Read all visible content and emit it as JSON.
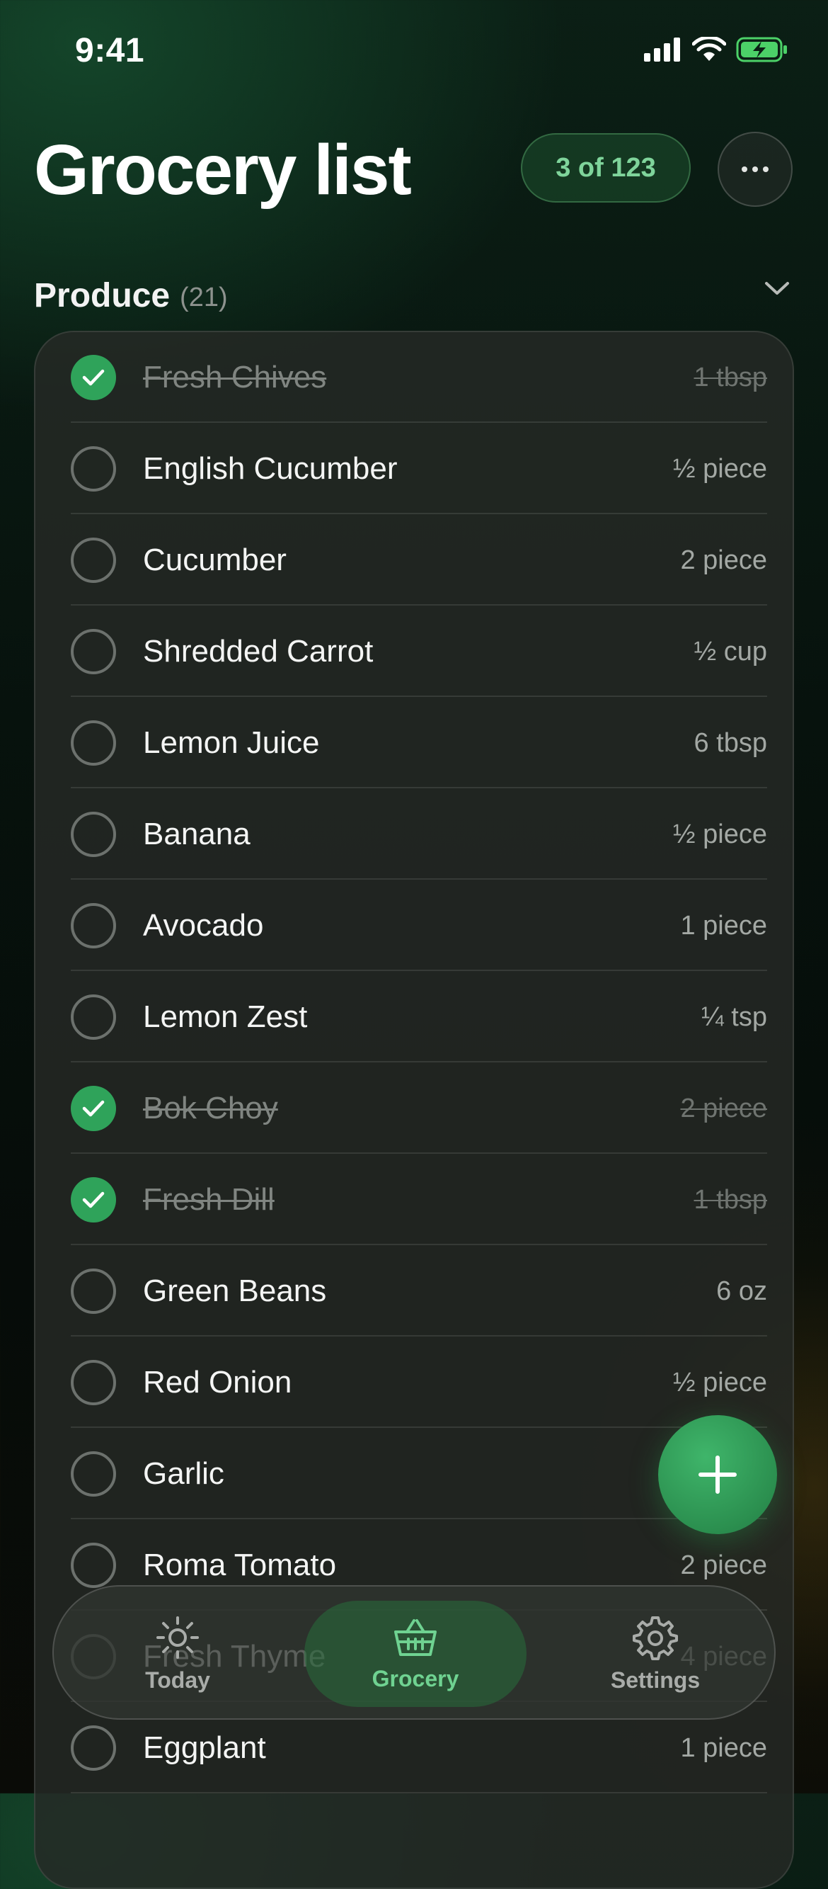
{
  "status_bar": {
    "time": "9:41"
  },
  "header": {
    "title": "Grocery list",
    "count_label": "3 of 123"
  },
  "section": {
    "title": "Produce",
    "count": "(21)",
    "items": [
      {
        "name": "Fresh Chives",
        "qty": "1 tbsp",
        "checked": true
      },
      {
        "name": "English Cucumber",
        "qty": "½ piece",
        "checked": false
      },
      {
        "name": "Cucumber",
        "qty": "2 piece",
        "checked": false
      },
      {
        "name": "Shredded Carrot",
        "qty": "½ cup",
        "checked": false
      },
      {
        "name": "Lemon Juice",
        "qty": "6 tbsp",
        "checked": false
      },
      {
        "name": "Banana",
        "qty": "½ piece",
        "checked": false
      },
      {
        "name": "Avocado",
        "qty": "1 piece",
        "checked": false
      },
      {
        "name": "Lemon Zest",
        "qty": "¼ tsp",
        "checked": false
      },
      {
        "name": "Bok Choy",
        "qty": "2 piece",
        "checked": true
      },
      {
        "name": "Fresh Dill",
        "qty": "1 tbsp",
        "checked": true
      },
      {
        "name": "Green Beans",
        "qty": "6 oz",
        "checked": false
      },
      {
        "name": "Red Onion",
        "qty": "½ piece",
        "checked": false
      },
      {
        "name": "Garlic",
        "qty": "",
        "checked": false
      },
      {
        "name": "Roma Tomato",
        "qty": "2 piece",
        "checked": false
      },
      {
        "name": "Fresh Thyme",
        "qty": "4 piece",
        "checked": false
      },
      {
        "name": "Eggplant",
        "qty": "1 piece",
        "checked": false
      }
    ]
  },
  "tabs": [
    {
      "label": "Today",
      "icon": "sun-icon"
    },
    {
      "label": "Grocery",
      "icon": "basket-icon",
      "active": true
    },
    {
      "label": "Settings",
      "icon": "gear-icon"
    }
  ],
  "colors": {
    "accent": "#2fa35a",
    "accent_text": "#7fd49b"
  }
}
